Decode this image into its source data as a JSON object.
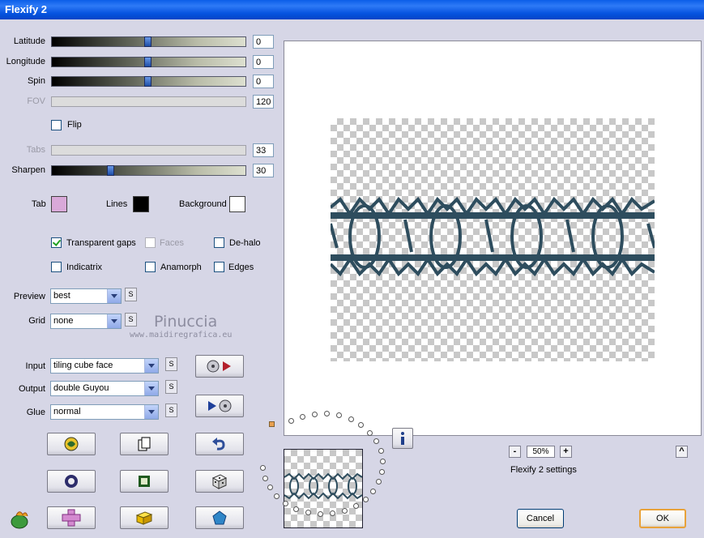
{
  "window": {
    "title": "Flexify 2"
  },
  "sliders": [
    {
      "label": "Latitude",
      "value": "0",
      "position": 0.5,
      "enabled": true
    },
    {
      "label": "Longitude",
      "value": "0",
      "position": 0.5,
      "enabled": true
    },
    {
      "label": "Spin",
      "value": "0",
      "position": 0.5,
      "enabled": true
    },
    {
      "label": "FOV",
      "value": "120",
      "enabled": false
    },
    {
      "label": "Tabs",
      "value": "33",
      "enabled": false
    },
    {
      "label": "Sharpen",
      "value": "30",
      "position": 0.3,
      "enabled": true
    }
  ],
  "flip": {
    "label": "Flip",
    "checked": false
  },
  "colors": {
    "tab": {
      "label": "Tab",
      "color": "#d9a9d9"
    },
    "lines": {
      "label": "Lines",
      "color": "#000000"
    },
    "background": {
      "label": "Background",
      "color": "#ffffff"
    }
  },
  "options": {
    "transparent_gaps": {
      "label": "Transparent gaps",
      "checked": true
    },
    "faces": {
      "label": "Faces",
      "checked": false,
      "enabled": false
    },
    "de_halo": {
      "label": "De-halo",
      "checked": false
    },
    "indicatrix": {
      "label": "Indicatrix",
      "checked": false
    },
    "anamorph": {
      "label": "Anamorph",
      "checked": false
    },
    "edges": {
      "label": "Edges",
      "checked": false
    }
  },
  "dropdowns": {
    "preview": {
      "label": "Preview",
      "value": "best"
    },
    "grid": {
      "label": "Grid",
      "value": "none"
    },
    "input": {
      "label": "Input",
      "value": "tiling cube face"
    },
    "output": {
      "label": "Output",
      "value": "double Guyou"
    },
    "glue": {
      "label": "Glue",
      "value": "normal"
    }
  },
  "s_button_label": "S",
  "watermark": {
    "name": "Pinuccia",
    "url": "www.maidiregrafica.eu"
  },
  "zoom": {
    "value": "50%",
    "minus": "-",
    "plus": "+",
    "collapse": "^"
  },
  "settings_label": "Flexify 2 settings",
  "buttons": {
    "cancel": "Cancel",
    "ok": "OK"
  },
  "icons": {
    "input_play": "disc-to-play-icon",
    "output_play": "play-to-disc-icon",
    "info": "info-icon",
    "logo": "flaming-pear-icon"
  },
  "accent": {
    "title_blue": "#0a5ee8",
    "slate_pattern": "#2e4d5e"
  }
}
